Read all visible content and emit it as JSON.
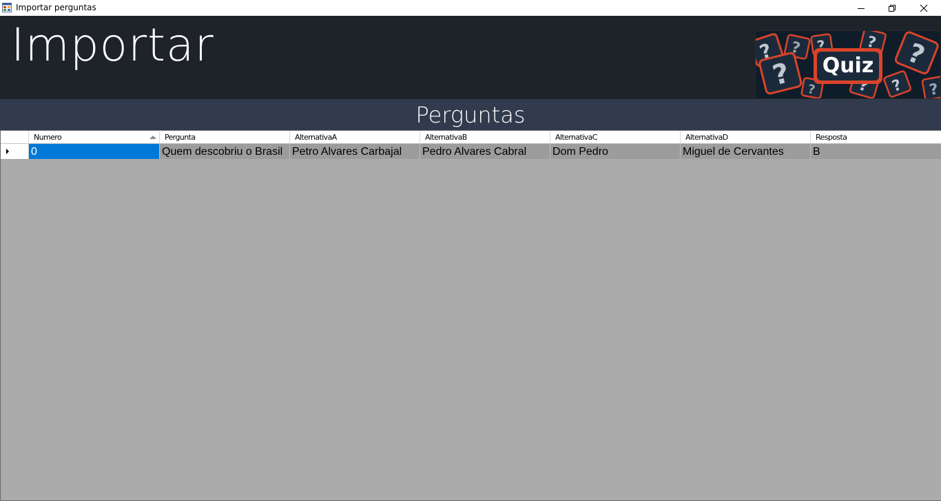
{
  "window": {
    "title": "Importar perguntas"
  },
  "header": {
    "title": "Importar",
    "logo_text": "Quiz"
  },
  "section": {
    "title": "Perguntas"
  },
  "grid": {
    "columns": [
      "Numero",
      "Pergunta",
      "AlternativaA",
      "AlternativaB",
      "AlternativaC",
      "AlternativaD",
      "Resposta"
    ],
    "sorted_column": "Numero",
    "sort_direction": "ascending",
    "rows": [
      [
        "0",
        "Quem descobriu o Brasil",
        "Petro Alvares Carbajal",
        "Pedro Alvares Cabral",
        "Dom Pedro",
        "Miguel de Cervantes",
        "B"
      ]
    ],
    "selected_cell": "0"
  },
  "colors": {
    "header_bg": "#1e2329",
    "section_bg": "#313b4d",
    "grid_bg": "#ababab",
    "row_bg": "#9c9c9c",
    "selection": "#0078d7",
    "logo_accent": "#e0452c"
  },
  "icons": [
    "app-form-icon",
    "minimize-icon",
    "restore-icon",
    "close-icon",
    "sort-ascending-icon",
    "current-row-icon"
  ]
}
